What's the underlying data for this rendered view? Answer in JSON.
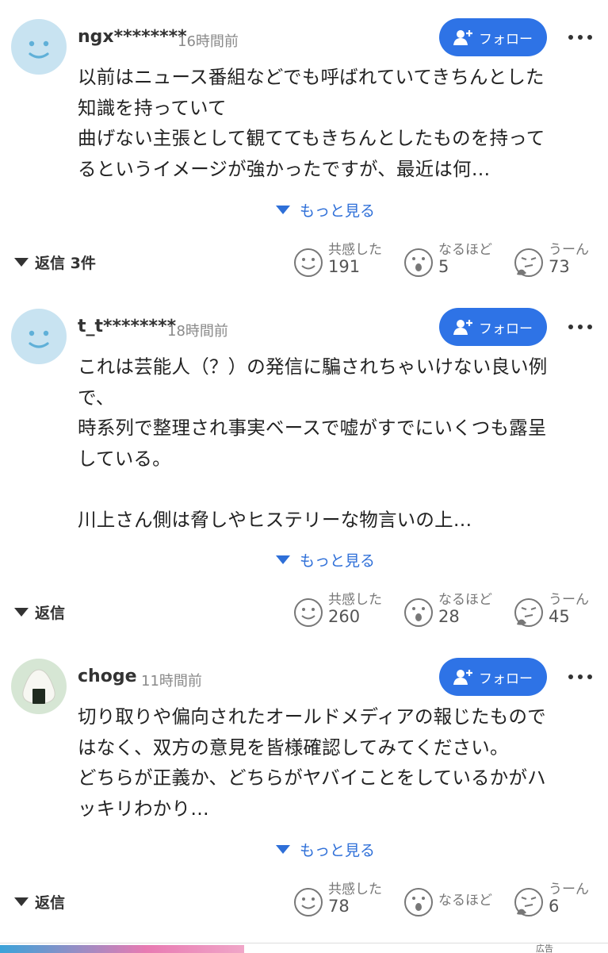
{
  "comments": [
    {
      "username": "ngx********",
      "time": "16時間前",
      "follow_label": "フォロー",
      "avatar": "smile-face-icon",
      "lines": [
        "以前はニュース番組などでも呼ばれていてきちんとした",
        "知識を持っていて",
        "曲げない主張として観ててもきちんとしたものを持って",
        "るというイメージが強かったですが、最近は何…"
      ],
      "show_more": "もっと見る",
      "reply": "返信 3件",
      "reactions": [
        {
          "label": "共感した",
          "count": "191",
          "icon": "smile-reaction-icon"
        },
        {
          "label": "なるほど",
          "count": "5",
          "icon": "surprised-reaction-icon"
        },
        {
          "label": "うーん",
          "count": "73",
          "icon": "thinking-reaction-icon"
        }
      ]
    },
    {
      "username": "t_t********",
      "time": "18時間前",
      "follow_label": "フォロー",
      "avatar": "smile-face-icon",
      "lines": [
        "これは芸能人（？）の発信に騙されちゃいけない良い例",
        "で、",
        "時系列で整理され事実ベースで嘘がすでにいくつも露呈",
        "している。",
        "",
        "川上さん側は脅しやヒステリーな物言いの上…"
      ],
      "show_more": "もっと見る",
      "reply": "返信",
      "reactions": [
        {
          "label": "共感した",
          "count": "260",
          "icon": "smile-reaction-icon"
        },
        {
          "label": "なるほど",
          "count": "28",
          "icon": "surprised-reaction-icon"
        },
        {
          "label": "うーん",
          "count": "45",
          "icon": "thinking-reaction-icon"
        }
      ]
    },
    {
      "username": "choge",
      "time": "11時間前",
      "follow_label": "フォロー",
      "avatar": "onigiri-icon",
      "lines": [
        "切り取りや偏向されたオールドメディアの報じたもので",
        "はなく、双方の意見を皆様確認してみてください。",
        "どちらが正義か、どちらがヤバイことをしているかがハ",
        "ッキリわかり…"
      ],
      "show_more": "もっと見る",
      "reply": "返信",
      "reactions": [
        {
          "label": "共感した",
          "count": "78",
          "icon": "smile-reaction-icon"
        },
        {
          "label": "なるほど",
          "count": "",
          "icon": "surprised-reaction-icon"
        },
        {
          "label": "うーん",
          "count": "6",
          "icon": "thinking-reaction-icon"
        }
      ]
    }
  ],
  "ad": {
    "label": "広告"
  },
  "colors": {
    "follow_button": "#2e73e6",
    "link": "#2e6fd8",
    "avatar_bg": "#c8e3f1"
  }
}
